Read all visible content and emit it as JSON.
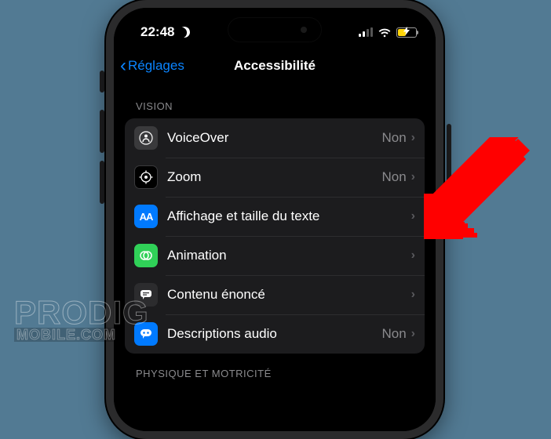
{
  "status": {
    "time": "22:48",
    "dnd": true,
    "signal_bars": 2,
    "wifi": true,
    "battery_charging": true
  },
  "nav": {
    "back_label": "Réglages",
    "title": "Accessibilité"
  },
  "sections": {
    "vision_header": "VISION",
    "physique_header": "PHYSIQUE ET MOTRICITÉ"
  },
  "rows": {
    "voiceover": {
      "label": "VoiceOver",
      "value": "Non"
    },
    "zoom": {
      "label": "Zoom",
      "value": "Non"
    },
    "display": {
      "label": "Affichage et taille du texte",
      "value": ""
    },
    "animation": {
      "label": "Animation",
      "value": ""
    },
    "spoken": {
      "label": "Contenu énoncé",
      "value": ""
    },
    "audiodesc": {
      "label": "Descriptions audio",
      "value": "Non"
    }
  },
  "watermark": {
    "line1": "PRODIG",
    "line2": "MOBILE.COM"
  }
}
